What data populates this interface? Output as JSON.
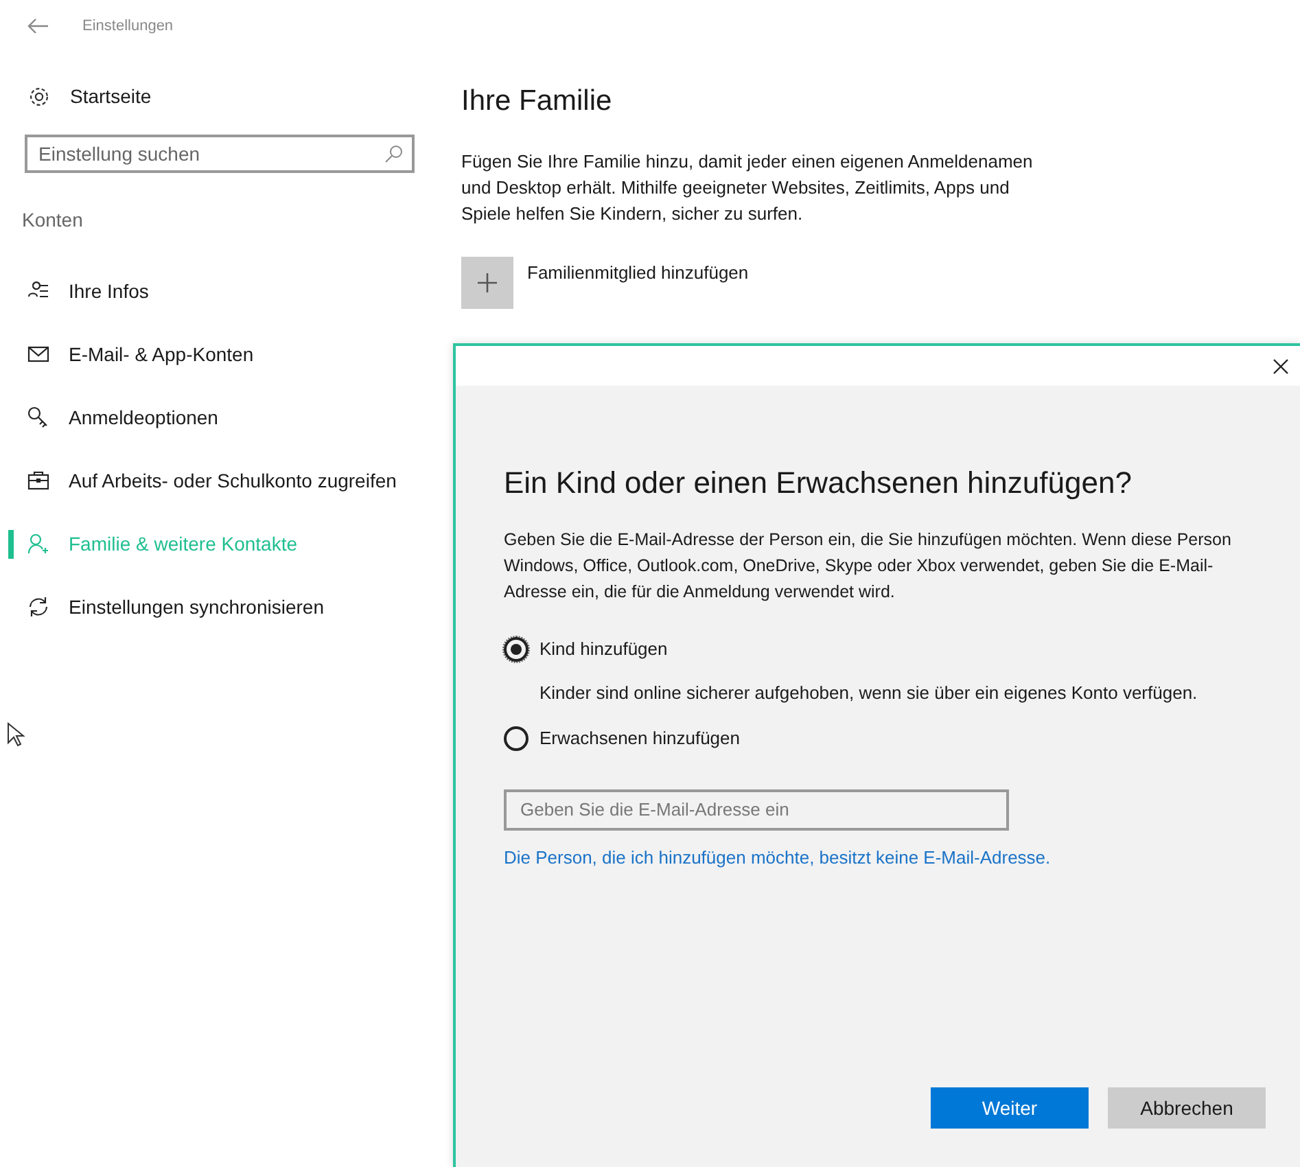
{
  "window": {
    "title": "Einstellungen"
  },
  "sidebar": {
    "home": "Startseite",
    "search": {
      "placeholder": "Einstellung suchen"
    },
    "section": "Konten",
    "items": [
      {
        "kind": "info",
        "label": "Ihre Infos",
        "selected": false
      },
      {
        "kind": "mail",
        "label": "E-Mail- & App-Konten",
        "selected": false
      },
      {
        "kind": "key",
        "label": "Anmeldeoptionen",
        "selected": false
      },
      {
        "kind": "work",
        "label": "Auf Arbeits- oder Schulkonto zugreifen",
        "selected": false
      },
      {
        "kind": "family",
        "label": "Familie & weitere Kontakte",
        "selected": true
      },
      {
        "kind": "sync",
        "label": "Einstellungen synchronisieren",
        "selected": false
      }
    ]
  },
  "main": {
    "title": "Ihre Familie",
    "description": "Fügen Sie Ihre Familie hinzu, damit jeder einen eigenen Anmeldenamen und Desktop erhält. Mithilfe geeigneter Websites, Zeitlimits, Apps und Spiele helfen Sie Kindern, sicher zu surfen.",
    "add_button": "Familienmitglied hinzufügen"
  },
  "dialog": {
    "title": "Ein Kind oder einen Erwachsenen hinzufügen?",
    "description": "Geben Sie die E-Mail-Adresse der Person ein, die Sie hinzufügen möchten. Wenn diese Person Windows, Office, Outlook.com, OneDrive, Skype oder Xbox verwendet, geben Sie die E-Mail-Adresse ein, die für die Anmeldung verwendet wird.",
    "options": [
      {
        "label": "Kind hinzufügen",
        "selected": true,
        "hint": "Kinder sind online sicherer aufgehoben, wenn sie über ein eigenes Konto verfügen."
      },
      {
        "label": "Erwachsenen hinzufügen",
        "selected": false
      }
    ],
    "email": {
      "placeholder": "Geben Sie die E-Mail-Adresse ein"
    },
    "link": "Die Person, die ich hinzufügen möchte, besitzt keine E-Mail-Adresse.",
    "buttons": [
      "Weiter",
      "Abbrechen"
    ]
  }
}
